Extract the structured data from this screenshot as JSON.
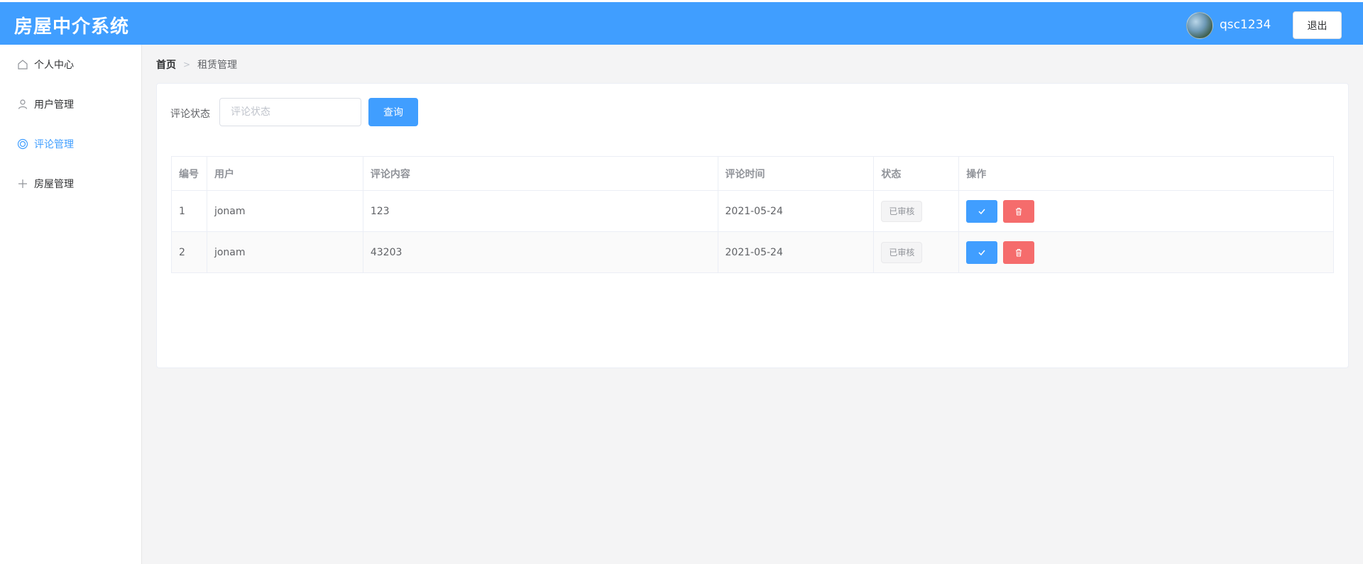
{
  "header": {
    "title": "房屋中介系统",
    "username": "qsc1234",
    "logout_label": "退出",
    "accent_color": "#409eff"
  },
  "sidebar": {
    "items": [
      {
        "label": "个人中心",
        "icon": "home-icon"
      },
      {
        "label": "用户管理",
        "icon": "user-icon"
      },
      {
        "label": "评论管理",
        "icon": "lifebuoy-icon",
        "active": true
      },
      {
        "label": "房屋管理",
        "icon": "plus-icon"
      }
    ]
  },
  "breadcrumb": {
    "home": "首页",
    "current": "租赁管理"
  },
  "filter": {
    "label": "评论状态",
    "placeholder": "评论状态",
    "query_label": "查询"
  },
  "table": {
    "headers": [
      "编号",
      "用户",
      "评论内容",
      "评论时间",
      "状态",
      "操作"
    ],
    "rows": [
      {
        "id": "1",
        "user": "jonam",
        "content": "123",
        "time": "2021-05-24",
        "status": "已审核"
      },
      {
        "id": "2",
        "user": "jonam",
        "content": "43203",
        "time": "2021-05-24",
        "status": "已审核"
      }
    ]
  }
}
